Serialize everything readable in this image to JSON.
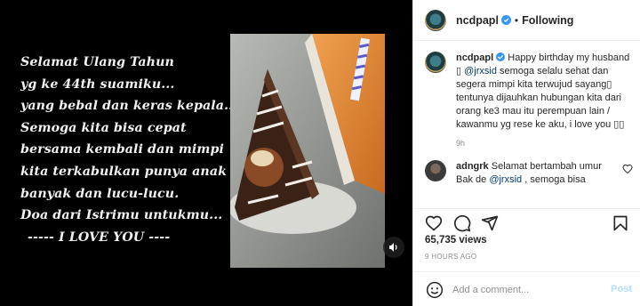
{
  "poem": {
    "lines": [
      "Selamat Ulang Tahun",
      "yg ke 44th suamiku...",
      "yang bebal dan keras kepala..",
      "Semoga kita bisa cepat",
      "bersama kembali dan mimpi",
      "kita terkabulkan punya anak",
      "banyak dan lucu-lucu.",
      "Doa dari Istrimu untukmu...",
      "----- I LOVE YOU ----"
    ]
  },
  "header": {
    "username": "ncdpapl",
    "separator": "•",
    "follow_label": "Following"
  },
  "caption": {
    "username": "ncdpapl",
    "text_before_mention": "Happy birthday my husband ▯ ",
    "mention": "@jrxsid",
    "text_after_mention": " semoga selalu sehat dan segera mimpi kita terwujud sayang▯ tentunya dijauhkan hubungan kita dari orang ke3 mau itu perempuan lain / kawanmu yg rese ke aku, i love you ▯▯",
    "time": "9h"
  },
  "comment": {
    "username": "adngrk",
    "text_before_mention": "Selamat bertambah umur Bak de ",
    "mention": "@jrxsid",
    "text_after_mention": " , semoga bisa"
  },
  "stats": {
    "views": "65,735 views",
    "posted_ago": "9 HOURS AGO"
  },
  "add_comment": {
    "placeholder": "Add a comment...",
    "post_label": "Post"
  },
  "colors": {
    "verified": "#3897f0",
    "link": "#00376b",
    "post_disabled": "#b2dffc",
    "media_bg": "#000000"
  },
  "icons": [
    "verified-icon",
    "volume-icon",
    "heart-icon",
    "comment-icon",
    "share-icon",
    "bookmark-icon",
    "emoji-icon"
  ]
}
